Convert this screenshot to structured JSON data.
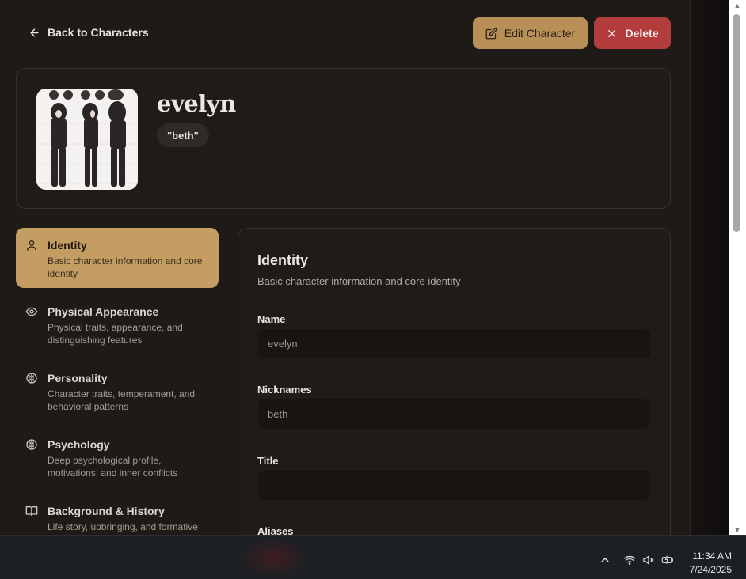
{
  "header": {
    "back_label": "Back to Characters",
    "edit_label": "Edit Character",
    "delete_label": "Delete"
  },
  "character": {
    "name": "evelyn",
    "nickname_badge": "\"beth\""
  },
  "sidebar": {
    "items": [
      {
        "title": "Identity",
        "desc": "Basic character information and core identity",
        "icon": "user-icon",
        "active": true
      },
      {
        "title": "Physical Appearance",
        "desc": "Physical traits, appearance, and distinguishing features",
        "icon": "eye-icon",
        "active": false
      },
      {
        "title": "Personality",
        "desc": "Character traits, temperament, and behavioral patterns",
        "icon": "brain-icon",
        "active": false
      },
      {
        "title": "Psychology",
        "desc": "Deep psychological profile, motivations, and inner conflicts",
        "icon": "brain-icon",
        "active": false
      },
      {
        "title": "Background & History",
        "desc": "Life story, upbringing, and formative",
        "icon": "book-icon",
        "active": false
      }
    ]
  },
  "section": {
    "title": "Identity",
    "desc": "Basic character information and core identity",
    "fields": [
      {
        "label": "Name",
        "value": "evelyn"
      },
      {
        "label": "Nicknames",
        "value": "beth"
      },
      {
        "label": "Title",
        "value": ""
      },
      {
        "label": "Aliases",
        "value": ""
      }
    ]
  },
  "taskbar": {
    "time": "11:34 AM",
    "date": "7/24/2025"
  },
  "colors": {
    "accent": "#c49d62",
    "edit_button": "#b98f58",
    "delete_button": "#b33c3c",
    "background": "#1e1a17"
  }
}
